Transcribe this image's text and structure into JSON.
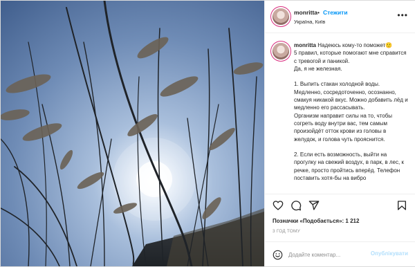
{
  "post": {
    "username": "monritta",
    "follow_label": "Стежити",
    "location": "Україна, Київ",
    "caption": {
      "username": "monritta",
      "lines": [
        "Надеюсь кому-то поможет🙂",
        "5 правил, которые помогают мне справится с тревогой и паникой.",
        "Да, я не железная.",
        "",
        "1. Выпить стакан холодной воды. Медленно, сосредоточенно, осознанно, смакуя никакой вкус. Можно добавить лёд и медленно его рассасывать.",
        "Организм направит силы на то, чтобы согреть воду внутри вас, тем самым произойдёт отток крови из головы в желудок, и голова чуть прояснится.",
        "",
        "2. Если есть возможность, выйти на прогулку на свежий воздух, в парк, в лес, к речке, просто пройтись вперёд. Телефон поставить хотя-бы на вибро"
      ]
    },
    "likes_text": "Позначки «Подобається»: 1 212",
    "time_ago": "3 ГОД ТОМУ",
    "comment_placeholder": "Додайте коментар...",
    "publish_label": "Опублікувати"
  },
  "icons": {
    "more": "more-horizontal-icon",
    "like": "heart-icon",
    "comment": "comment-icon",
    "share": "paper-plane-icon",
    "save": "bookmark-icon",
    "emoji": "smiley-icon"
  },
  "colors": {
    "accent": "#0095f6",
    "publish_disabled": "#b2dffc",
    "muted": "#8e8e8e",
    "text": "#262626",
    "border": "#dbdbdb"
  }
}
